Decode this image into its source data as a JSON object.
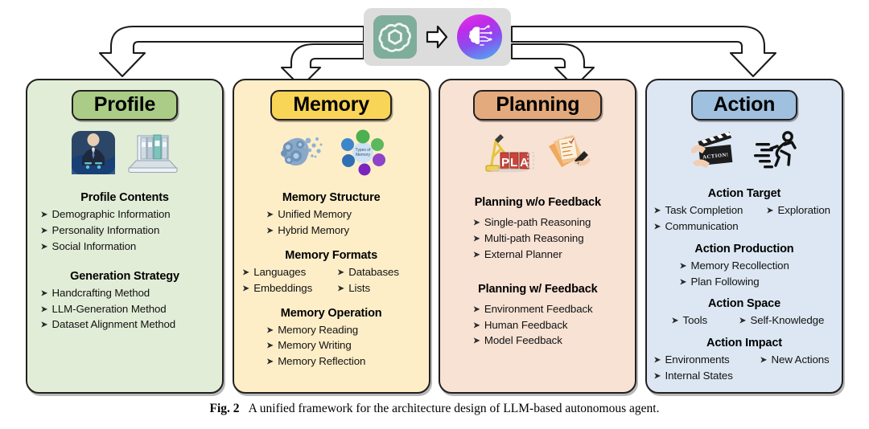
{
  "figure": {
    "caption_label": "Fig. 2",
    "caption_text": "A unified framework for the architecture design of LLM-based autonomous agent."
  },
  "header": {
    "source_icon": "openai-logo-icon",
    "transition_icon": "block-arrow-right-icon",
    "target_icon": "ai-brain-icon"
  },
  "flow_arrows": [
    {
      "name": "arrow-to-profile",
      "target": "Profile"
    },
    {
      "name": "arrow-to-memory",
      "target": "Memory"
    },
    {
      "name": "arrow-to-planning",
      "target": "Planning"
    },
    {
      "name": "arrow-to-action",
      "target": "Action"
    }
  ],
  "colors": {
    "profile_panel": "#e2edd7",
    "profile_title": "#aacc87",
    "memory_panel": "#fdeec8",
    "memory_title": "#f8d457",
    "planning_panel": "#f7e2d4",
    "planning_title": "#e3ab7d",
    "action_panel": "#dce7f3",
    "action_title": "#9fc0de",
    "logo_bar": "#dcdcdc",
    "outline": "#231f20"
  },
  "panels": [
    {
      "id": "profile",
      "title": "Profile",
      "icons": [
        "businessman-data-icon",
        "laptop-binders-icon"
      ],
      "sections": [
        {
          "heading": "Profile Contents",
          "layout": "single",
          "items": [
            "Demographic  Information",
            "Personality Information",
            "Social Information"
          ]
        },
        {
          "heading": "Generation Strategy",
          "layout": "single",
          "items": [
            "Handcrafting Method",
            "LLM-Generation Method",
            "Dataset  Alignment Method"
          ]
        }
      ]
    },
    {
      "id": "memory",
      "title": "Memory",
      "icons": [
        "brain-network-icon",
        "types-of-memory-diagram-icon"
      ],
      "sections": [
        {
          "heading": "Memory Structure",
          "layout": "single",
          "items": [
            "Unified Memory",
            "Hybrid Memory"
          ]
        },
        {
          "heading": "Memory Formats",
          "layout": "two-column",
          "rows": [
            [
              "Languages",
              "Databases"
            ],
            [
              "Embeddings",
              "Lists"
            ]
          ]
        },
        {
          "heading": "Memory Operation",
          "layout": "single",
          "items": [
            "Memory Reading",
            "Memory Writing",
            "Memory Reflection"
          ]
        }
      ]
    },
    {
      "id": "planning",
      "title": "Planning",
      "icons": [
        "plan-blocks-crane-icon",
        "notes-writing-hand-icon"
      ],
      "sections": [
        {
          "heading": "Planning w/o Feedback",
          "layout": "single",
          "items": [
            "Single-path Reasoning",
            "Multi-path Reasoning",
            "External Planner"
          ]
        },
        {
          "heading": "Planning w/ Feedback",
          "layout": "single",
          "items": [
            "Environment Feedback",
            "Human Feedback",
            "Model Feedback"
          ]
        }
      ]
    },
    {
      "id": "action",
      "title": "Action",
      "icons": [
        "clapperboard-hands-icon",
        "running-person-icon"
      ],
      "sections": [
        {
          "heading": "Action Target",
          "layout": "two-column",
          "rows": [
            [
              "Task Completion",
              "Exploration"
            ],
            [
              "Communication",
              ""
            ]
          ]
        },
        {
          "heading": "Action Production",
          "layout": "single",
          "items": [
            "Memory Recollection",
            "Plan Following"
          ]
        },
        {
          "heading": "Action Space",
          "layout": "two-column",
          "rows": [
            [
              "Tools",
              "Self-Knowledge"
            ]
          ]
        },
        {
          "heading": "Action Impact",
          "layout": "two-column",
          "rows": [
            [
              "Environments",
              "New Actions"
            ],
            [
              "Internal States",
              ""
            ]
          ]
        }
      ]
    }
  ]
}
